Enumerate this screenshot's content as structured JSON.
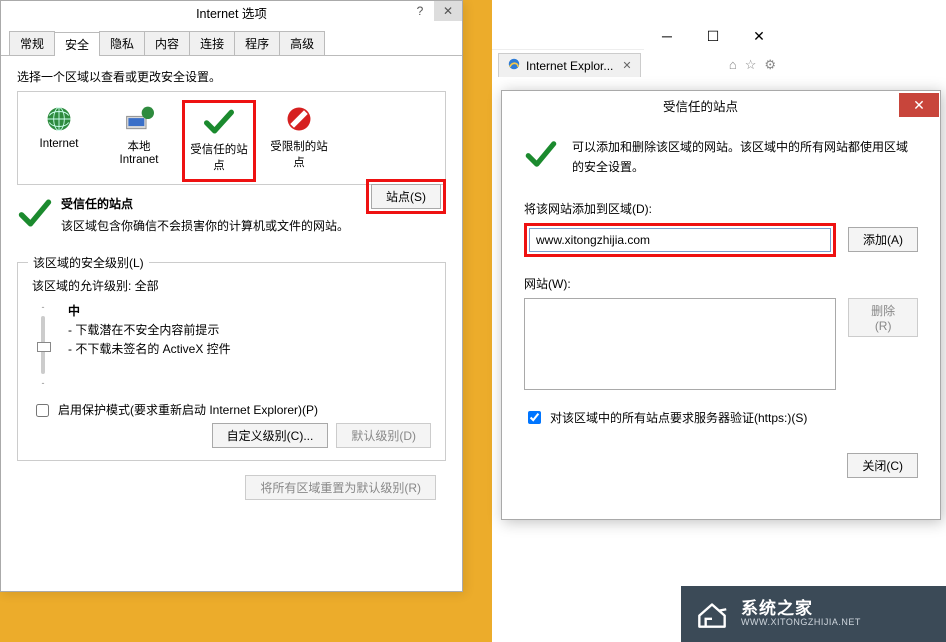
{
  "dlg1": {
    "title": "Internet 选项",
    "tabs": [
      "常规",
      "安全",
      "隐私",
      "内容",
      "连接",
      "程序",
      "高级"
    ],
    "activeTabIndex": 1,
    "intro": "选择一个区域以查看或更改安全设置。",
    "zones": {
      "internet": "Internet",
      "intranet": "本地\nIntranet",
      "trusted": "受信任的站\n点",
      "restricted": "受限制的站\n点"
    },
    "selectedZoneTitle": "受信任的站点",
    "selectedZoneDesc": "该区域包含你确信不会损害你的计算机或文件的网站。",
    "sitesBtn": "站点(S)",
    "levelGroupLegend": "该区域的安全级别(L)",
    "allowedLabel": "该区域的允许级别: 全部",
    "levelName": "中",
    "levelBullets": [
      "- 下载潜在不安全内容前提示",
      "- 不下载未签名的 ActiveX 控件"
    ],
    "protectedMode": "启用保护模式(要求重新启动 Internet Explorer)(P)",
    "customLevelBtn": "自定义级别(C)...",
    "defaultLevelBtn": "默认级别(D)",
    "resetBtn": "将所有区域重置为默认级别(R)"
  },
  "ieWin": {
    "tabLabel": "Internet Explor...",
    "toolbarIcons": [
      "⌂",
      "☆",
      "⚙"
    ]
  },
  "dlg2": {
    "title": "受信任的站点",
    "intro": "可以添加和删除该区域的网站。该区域中的所有网站都使用区域的安全设置。",
    "addLabel": "将该网站添加到区域(D):",
    "url": "www.xitongzhijia.com",
    "addBtn": "添加(A)",
    "sitesLabel": "网站(W):",
    "removeBtn": "删除(R)",
    "httpsLabel": "对该区域中的所有站点要求服务器验证(https:)(S)",
    "httpsChecked": true,
    "closeBtn": "关闭(C)"
  },
  "watermark": {
    "name": "系统之家",
    "url": "WWW.XITONGZHIJIA.NET"
  }
}
